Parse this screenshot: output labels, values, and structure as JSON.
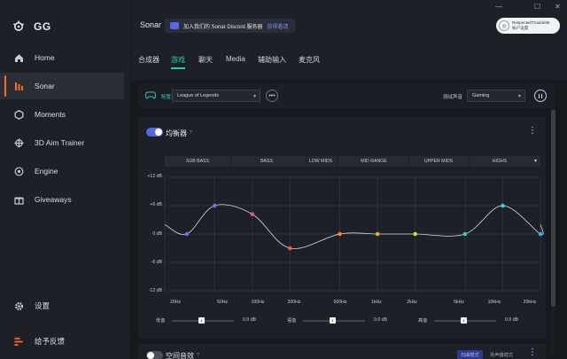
{
  "app": {
    "title": "GG"
  },
  "sidebar": {
    "items": [
      {
        "label": "Home",
        "icon": "home-icon"
      },
      {
        "label": "Sonar",
        "icon": "sonar-icon"
      },
      {
        "label": "Moments",
        "icon": "moments-icon"
      },
      {
        "label": "3D Aim Trainer",
        "icon": "aim-trainer-icon"
      },
      {
        "label": "Engine",
        "icon": "engine-icon"
      },
      {
        "label": "Giveaways",
        "icon": "gift-icon"
      }
    ],
    "bottom": [
      {
        "label": "设置",
        "icon": "gear-icon"
      },
      {
        "label": "给予反馈",
        "icon": "feedback-icon"
      }
    ],
    "active_index": 1,
    "accent": "#ff6a1f"
  },
  "header": {
    "title": "Sonar",
    "discord_text": "加入我们的 Sonar Discord 服务器",
    "discord_link": "获得邀请",
    "user_name": "RespectedTrouble96",
    "user_sub": "帐户设置"
  },
  "tabs": [
    {
      "label": "合成器"
    },
    {
      "label": "游戏"
    },
    {
      "label": "聊天"
    },
    {
      "label": "Media"
    },
    {
      "label": "辅助输入"
    },
    {
      "label": "麦克风"
    }
  ],
  "active_tab": 1,
  "config": {
    "label": "配置:",
    "profile": "League of Legends",
    "test_label": "测试声音",
    "test_value": "Gaming"
  },
  "equalizer": {
    "title": "均衡器",
    "enabled": true,
    "bands": [
      "SUB BASS",
      "BASS",
      "LOW MIDS",
      "MID RANGE",
      "UPPER MIDS",
      "HIGHS"
    ],
    "y_ticks": [
      "+12 dB",
      "+6 dB",
      "0 dB",
      "-6 dB",
      "-12 dB"
    ],
    "x_ticks": [
      "20Hz",
      "50Hz",
      "100Hz",
      "200Hz",
      "500Hz",
      "1kHz",
      "2kHz",
      "5kHz",
      "10kHz",
      "20kHz"
    ],
    "points_colors": [
      "#6f6cf0",
      "#6f6cf0",
      "#f04f7a",
      "#f05a3c",
      "#ff7a3a",
      "#f2a43a",
      "#c9df3c",
      "#33d3a8",
      "#33d3d3",
      "#3aa9f2"
    ]
  },
  "chart_data": {
    "type": "line",
    "x": [
      30,
      50,
      100,
      200,
      500,
      1000,
      2000,
      5000,
      10000,
      20000
    ],
    "x_scale": "log",
    "series": [
      {
        "values": [
          0,
          6,
          4.2,
          -3,
          0,
          0,
          0,
          0,
          6,
          0
        ]
      }
    ],
    "ylim": [
      -12,
      12
    ],
    "xlim": [
      20,
      20000
    ],
    "grid": true
  },
  "sliders": [
    {
      "label": "低音",
      "value": "0.0 dB"
    },
    {
      "label": "语音",
      "value": "0.0 dB"
    },
    {
      "label": "高音",
      "value": "0.0 dB"
    }
  ],
  "spatial": {
    "title": "空间音效",
    "enabled": false,
    "mode_active": "扫曲模式",
    "mode_other": "扬声器模式"
  }
}
